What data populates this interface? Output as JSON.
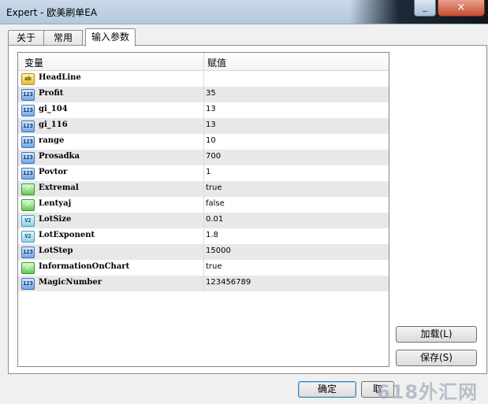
{
  "window": {
    "title": "Expert - 欧美刷单EA",
    "minimize_glyph": "_",
    "close_glyph": "×"
  },
  "tabs": [
    {
      "label": "关于"
    },
    {
      "label": "常用"
    },
    {
      "label": "输入参数",
      "active": true
    }
  ],
  "grid": {
    "columns": {
      "variable": "变量",
      "value": "赋值"
    },
    "rows": [
      {
        "type": "string",
        "icon": "ab",
        "name": "HeadLine",
        "value": ""
      },
      {
        "type": "int",
        "icon": "123",
        "name": "Profit",
        "value": "35"
      },
      {
        "type": "int",
        "icon": "123",
        "name": "gi_104",
        "value": "13"
      },
      {
        "type": "int",
        "icon": "123",
        "name": "gi_116",
        "value": "13"
      },
      {
        "type": "int",
        "icon": "123",
        "name": "range",
        "value": "10"
      },
      {
        "type": "int",
        "icon": "123",
        "name": "Prosadka",
        "value": "700"
      },
      {
        "type": "int",
        "icon": "123",
        "name": "Povtor",
        "value": "1"
      },
      {
        "type": "bool",
        "icon": "✓",
        "name": "Extremal",
        "value": "true"
      },
      {
        "type": "bool",
        "icon": "✓",
        "name": "Lentyaj",
        "value": "false"
      },
      {
        "type": "double",
        "icon": "V2",
        "name": "LotSize",
        "value": "0.01"
      },
      {
        "type": "double",
        "icon": "V2",
        "name": "LotExponent",
        "value": "1.8"
      },
      {
        "type": "int",
        "icon": "123",
        "name": "LotStep",
        "value": "15000"
      },
      {
        "type": "bool",
        "icon": "✓",
        "name": "InformationOnChart",
        "value": "true"
      },
      {
        "type": "int",
        "icon": "123",
        "name": "MagicNumber",
        "value": "123456789"
      }
    ]
  },
  "buttons": {
    "load": "加载(L)",
    "save": "保存(S)",
    "ok": "确定",
    "cancel": "取"
  },
  "watermark": "618外汇网"
}
